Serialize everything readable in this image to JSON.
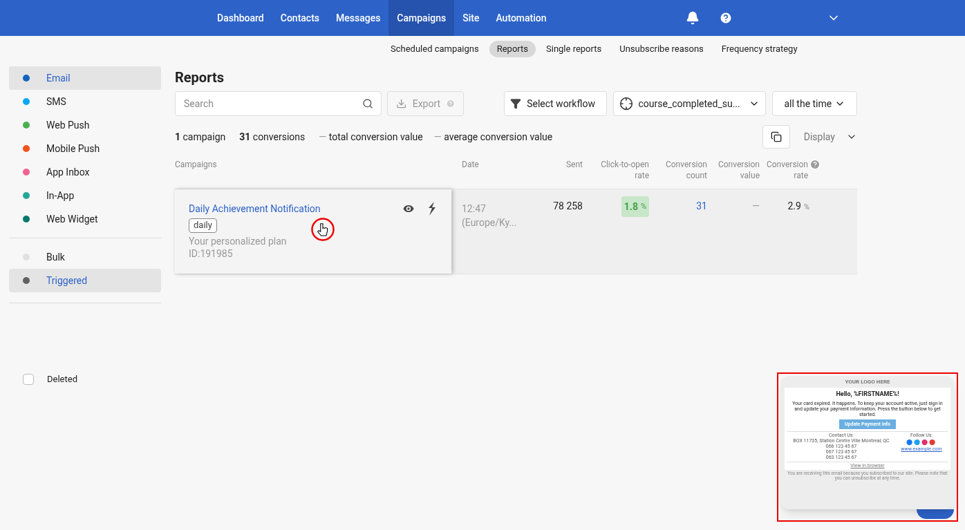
{
  "top_nav": [
    {
      "label": "Dashboard",
      "selected": false
    },
    {
      "label": "Contacts",
      "selected": false
    },
    {
      "label": "Messages",
      "selected": false
    },
    {
      "label": "Campaigns",
      "selected": true
    },
    {
      "label": "Site",
      "selected": false
    },
    {
      "label": "Automation",
      "selected": false
    }
  ],
  "sub_nav": [
    {
      "label": "Scheduled campaigns",
      "selected": false
    },
    {
      "label": "Reports",
      "selected": true
    },
    {
      "label": "Single reports",
      "selected": false
    },
    {
      "label": "Unsubscribe reasons",
      "selected": false
    },
    {
      "label": "Frequency strategy",
      "selected": false
    }
  ],
  "sidebar": {
    "channels": [
      {
        "label": "Email",
        "color": "#1565c0",
        "selected": true
      },
      {
        "label": "SMS",
        "color": "#03a9f4",
        "selected": false
      },
      {
        "label": "Web Push",
        "color": "#4caf50",
        "selected": false
      },
      {
        "label": "Mobile Push",
        "color": "#f4511e",
        "selected": false
      },
      {
        "label": "App Inbox",
        "color": "#f06292",
        "selected": false
      },
      {
        "label": "In-App",
        "color": "#26a69a",
        "selected": false
      },
      {
        "label": "Web Widget",
        "color": "#00796b",
        "selected": false
      }
    ],
    "types": [
      {
        "label": "Bulk",
        "color": "#e0e0e0",
        "selected": false
      },
      {
        "label": "Triggered",
        "color": "#616161",
        "selected": true
      }
    ],
    "deleted": {
      "label": "Deleted",
      "checked": false
    }
  },
  "page_title": "Reports",
  "search": {
    "placeholder": "Search"
  },
  "export_button": "Export",
  "workflow_button": "Select workflow",
  "event_select": "course_completed_su...",
  "period_select": "all the time",
  "summary": [
    {
      "count": "1",
      "label": "campaign"
    },
    {
      "count": "31",
      "label": "conversions"
    }
  ],
  "summary_dashes": [
    {
      "dash": "—",
      "label": "total conversion value"
    },
    {
      "dash": "—",
      "label": "average conversion value"
    }
  ],
  "display_button": "Display",
  "table": {
    "columns": [
      "Campaigns",
      "Date",
      "Sent",
      "Click-to-open rate",
      "Conversion count",
      "Conversion value",
      "Conversion rate"
    ],
    "rows": [
      {
        "name": "Daily Achievement Notification",
        "tag": "daily",
        "subject": "Your personalized plan",
        "id": "ID:191985",
        "time": "12:47",
        "timezone": "(Europe/Ky...",
        "sent": "78 258",
        "cto": "1.8",
        "cto_unit": "%",
        "conv_count": "31",
        "conv_value": "—",
        "conv_rate": "2.9",
        "conv_rate_unit": "%"
      }
    ]
  },
  "email_preview": {
    "logo": "YOUR LOGO HERE",
    "greeting": "Hello, %FIRSTNAME%!",
    "body": "Your card expired. It happens. To keep your account active, just sign in and update your payment information. Press the button below to get started.",
    "button": "Update Payment Info",
    "contact_title": "Contact Us:",
    "address": "BOX 11735, Station Centre Ville Montreal, QC",
    "phones": [
      "066 123 45 67",
      "067 123 45 67",
      "063 123 45 67"
    ],
    "follow_title": "Follow Us:",
    "website": "www.example.com",
    "view_link": "View in browser",
    "footer": "You are receiving this email because you subscribed to our site. Please note that you can unsubscribe at any time."
  }
}
